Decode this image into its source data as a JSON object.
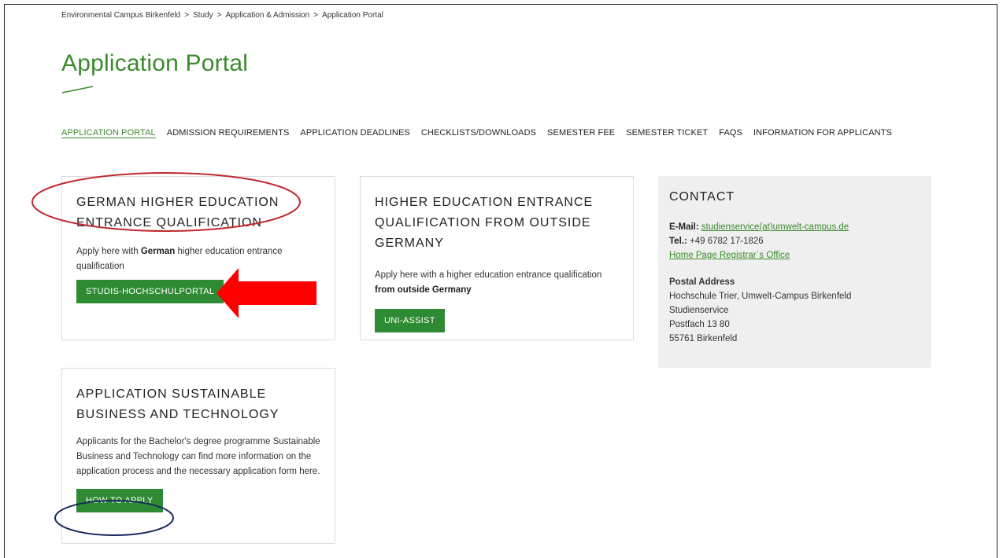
{
  "breadcrumb": [
    "Environmental Campus Birkenfeld",
    "Study",
    "Application & Admission",
    "Application Portal"
  ],
  "breadcrumb_sep": ">",
  "page_title": "Application Portal",
  "subnav": [
    {
      "label": "APPLICATION PORTAL",
      "active": true
    },
    {
      "label": "ADMISSION REQUIREMENTS"
    },
    {
      "label": "APPLICATION DEADLINES"
    },
    {
      "label": "CHECKLISTS/DOWNLOADS"
    },
    {
      "label": "SEMESTER FEE"
    },
    {
      "label": "SEMESTER TICKET"
    },
    {
      "label": "FAQS"
    },
    {
      "label": "INFORMATION FOR APPLICANTS"
    }
  ],
  "cards": {
    "german": {
      "title_line1": "GERMAN HIGHER EDUCATION",
      "title_line2": "ENTRANCE QUALIFICATION",
      "text_pre": "Apply here with ",
      "text_bold": "German",
      "text_post": " higher education entrance qualification",
      "button": "STUDIS-HOCHSCHULPORTAL"
    },
    "foreign": {
      "title_line1": "HIGHER EDUCATION ENTRANCE",
      "title_line2": "QUALIFICATION FROM OUTSIDE",
      "title_line3": "GERMANY",
      "text_pre": "Apply here with  a higher education entrance qualification ",
      "text_bold": "from outside Germany",
      "button": "UNI-ASSIST"
    },
    "sustainable": {
      "title_line1": "APPLICATION SUSTAINABLE",
      "title_line2": "BUSINESS AND TECHNOLOGY",
      "text": "Applicants for the Bachelor's degree programme Sustainable Business and Technology can find more information on the application process and the necessary application form here.",
      "button": "HOW TO APPLY"
    }
  },
  "contact": {
    "title": "CONTACT",
    "email_label": "E-Mail:",
    "email": "studienservice(at)umwelt-campus.de",
    "tel_label": "Tel.:",
    "tel": "+49 6782 17-1826",
    "home_link": "Home Page Registrar´s Office",
    "postal_heading": "Postal Address",
    "postal_lines": [
      "Hochschule Trier, Umwelt-Campus Birkenfeld",
      "Studienservice",
      "Postfach 13 80",
      "55761 Birkenfeld"
    ]
  },
  "colors": {
    "accent_green": "#3a8a2c",
    "button_green": "#2e8b33",
    "red_arrow": "#ff0000",
    "red_circle": "#c0282d",
    "blue_circle": "#1a2a5c"
  }
}
